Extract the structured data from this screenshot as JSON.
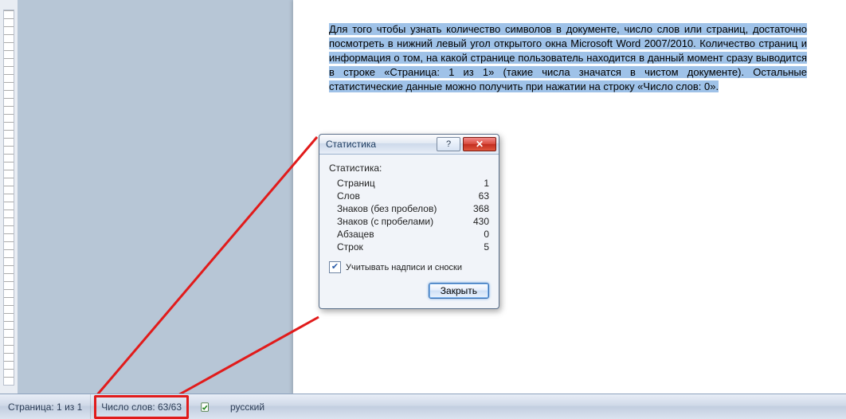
{
  "page": {
    "paragraph": "Для того чтобы узнать количество символов в документе, число слов или страниц, достаточно посмотреть в нижний левый угол открытого окна Microsoft Word 2007/2010. Количество страниц и информация о том, на какой странице пользователь находится в данный момент сразу выводится в строке «Страница: 1 из 1» (такие числа значатся в чистом документе). Остальные статистические данные можно получить при нажатии на строку «Число слов: 0»."
  },
  "dialog": {
    "title": "Статистика",
    "heading": "Статистика:",
    "rows": [
      {
        "label": "Страниц",
        "value": "1"
      },
      {
        "label": "Слов",
        "value": "63"
      },
      {
        "label": "Знаков (без пробелов)",
        "value": "368"
      },
      {
        "label": "Знаков (с пробелами)",
        "value": "430"
      },
      {
        "label": "Абзацев",
        "value": "0"
      },
      {
        "label": "Строк",
        "value": "5"
      }
    ],
    "checkbox_label": "Учитывать надписи и сноски",
    "checkbox_checked": true,
    "close_label": "Закрыть"
  },
  "statusbar": {
    "page_status": "Страница: 1 из 1",
    "word_count": "Число слов: 63/63",
    "language": "русский"
  }
}
